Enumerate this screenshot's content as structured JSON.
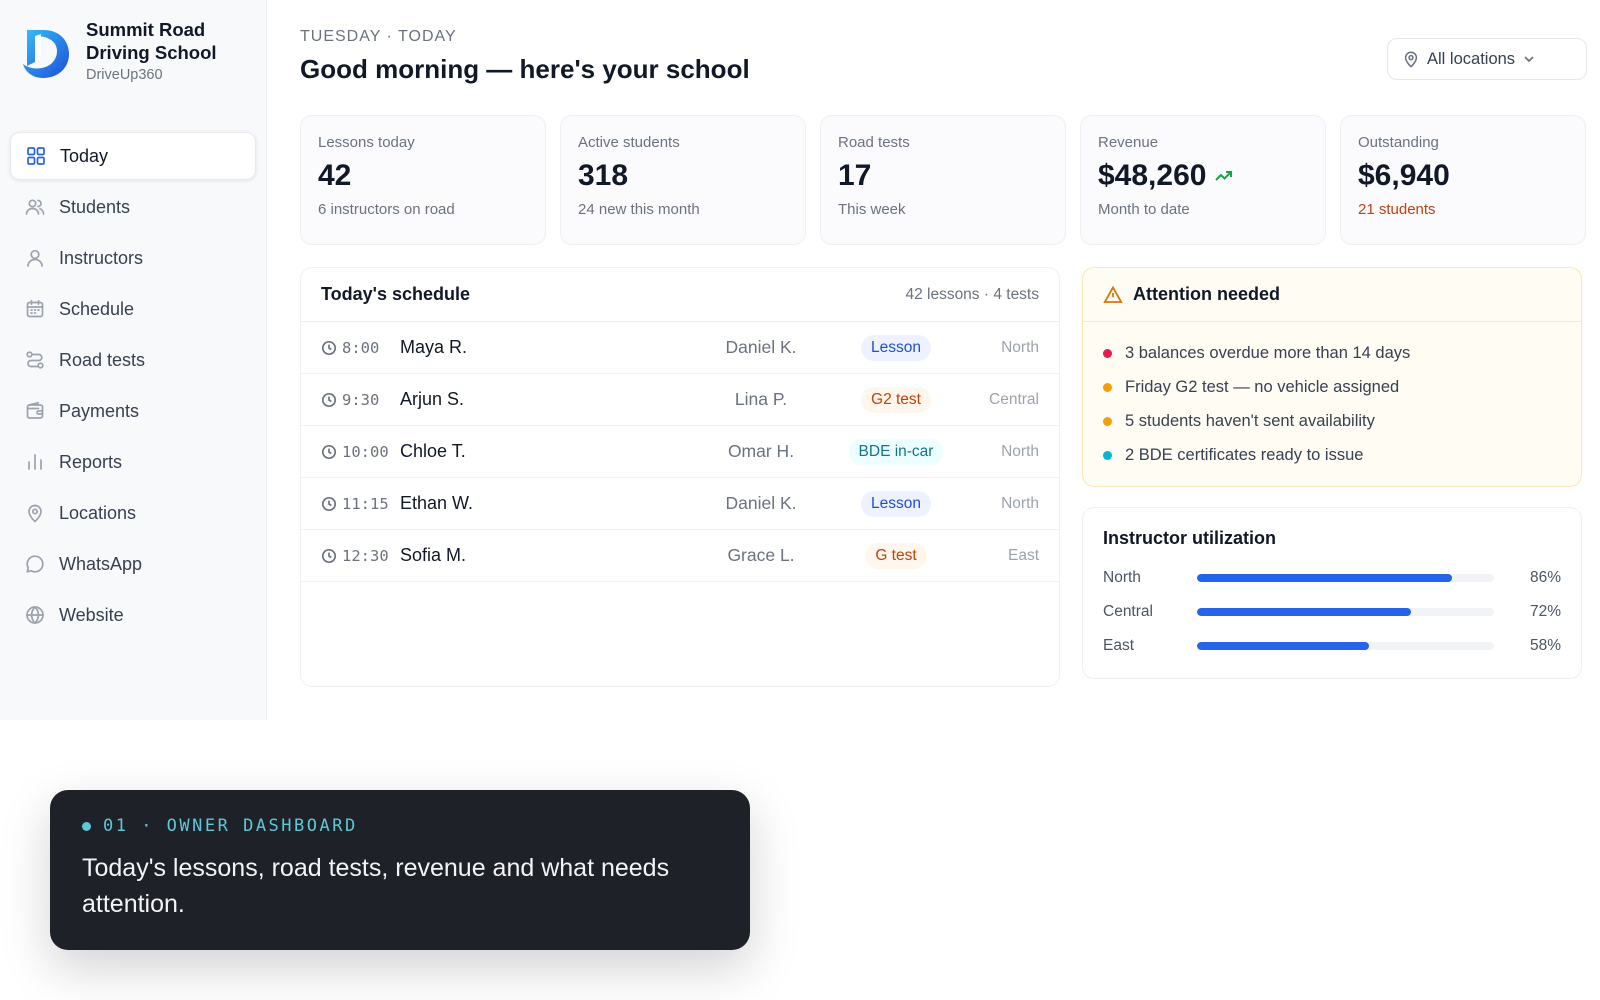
{
  "brand": {
    "name": "Summit Road Driving School",
    "product": "DriveUp360"
  },
  "sidebar": {
    "items": [
      {
        "label": "Today",
        "icon": "grid-icon",
        "active": true
      },
      {
        "label": "Students",
        "icon": "users-icon"
      },
      {
        "label": "Instructors",
        "icon": "user-icon"
      },
      {
        "label": "Schedule",
        "icon": "calendar-icon"
      },
      {
        "label": "Road tests",
        "icon": "route-icon"
      },
      {
        "label": "Payments",
        "icon": "wallet-icon"
      },
      {
        "label": "Reports",
        "icon": "bar-chart-icon"
      },
      {
        "label": "Locations",
        "icon": "map-pin-icon"
      },
      {
        "label": "WhatsApp",
        "icon": "chat-bubble-icon"
      },
      {
        "label": "Website",
        "icon": "globe-icon"
      }
    ]
  },
  "header": {
    "eyebrow": "TUESDAY · TODAY",
    "title": "Good morning — here's your school",
    "location_filter": "All locations"
  },
  "kpis": [
    {
      "label": "Lessons today",
      "value": "42",
      "sub": "6 instructors on road"
    },
    {
      "label": "Active students",
      "value": "318",
      "sub": "24 new this month"
    },
    {
      "label": "Road tests",
      "value": "17",
      "sub": "This week"
    },
    {
      "label": "Revenue",
      "value": "$48,260",
      "sub": "Month to date",
      "trend": "up"
    },
    {
      "label": "Outstanding",
      "value": "$6,940",
      "sub": "21 students",
      "sub_color": "#c2410c"
    }
  ],
  "schedule": {
    "title": "Today's schedule",
    "meta": "42 lessons · 4 tests",
    "rows": [
      {
        "time": "8:00",
        "student": "Maya R.",
        "instructor": "Daniel K.",
        "type": "Lesson",
        "kind": "lesson",
        "region": "North"
      },
      {
        "time": "9:30",
        "student": "Arjun S.",
        "instructor": "Lina P.",
        "type": "G2 test",
        "kind": "g2",
        "region": "Central"
      },
      {
        "time": "10:00",
        "student": "Chloe T.",
        "instructor": "Omar H.",
        "type": "BDE in-car",
        "kind": "bde",
        "region": "North"
      },
      {
        "time": "11:15",
        "student": "Ethan W.",
        "instructor": "Daniel K.",
        "type": "Lesson",
        "kind": "lesson",
        "region": "North"
      },
      {
        "time": "12:30",
        "student": "Sofia M.",
        "instructor": "Grace L.",
        "type": "G test",
        "kind": "g2",
        "region": "East"
      }
    ]
  },
  "attention": {
    "title": "Attention needed",
    "items": [
      {
        "text": "3 balances overdue more than 14 days",
        "color": "#e11d48"
      },
      {
        "text": "Friday G2 test — no vehicle assigned",
        "color": "#f59e0b"
      },
      {
        "text": "5 students haven't sent availability",
        "color": "#f59e0b"
      },
      {
        "text": "2 BDE certificates ready to issue",
        "color": "#06b6d4"
      }
    ]
  },
  "utilization": {
    "title": "Instructor utilization",
    "rows": [
      {
        "label": "North",
        "value": 0.86,
        "pct": "86%"
      },
      {
        "label": "Central",
        "value": 0.72,
        "pct": "72%"
      },
      {
        "label": "East",
        "value": 0.58,
        "pct": "58%"
      }
    ]
  },
  "caption": {
    "eyebrow": "01 · OWNER DASHBOARD",
    "text": "Today's lessons, road tests, revenue and what needs attention."
  },
  "colors": {
    "accent": "#2563eb",
    "warning": "#c2410c",
    "caption_bg": "#1f2128",
    "caption_accent": "#5ec8d8"
  }
}
